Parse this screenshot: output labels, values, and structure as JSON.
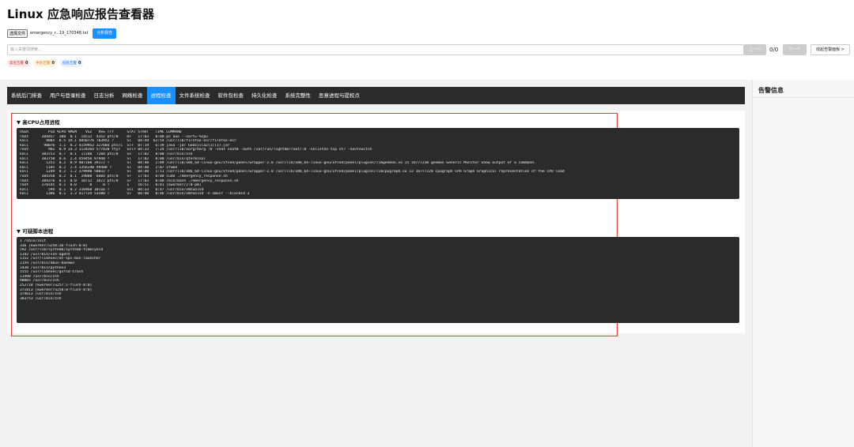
{
  "app": {
    "title": "Linux 应急响应报告查看器"
  },
  "file": {
    "choose_label": "选择文件",
    "file_name": "emergency_r...19_170348.txt",
    "analyze_label": "分析报告"
  },
  "search": {
    "placeholder": "输入关键词搜索...",
    "prev_label": "上一个",
    "match_count": "0/0",
    "next_label": "下一个",
    "toggle_label": "收起告警面板 >"
  },
  "badges": {
    "high": {
      "label": "高危告警",
      "count": "0"
    },
    "mid": {
      "label": "中危告警",
      "count": "0"
    },
    "low": {
      "label": "低危告警",
      "count": "0"
    }
  },
  "tabs": [
    {
      "label": "系统后门排查",
      "active": false
    },
    {
      "label": "用户与登录检查",
      "active": false
    },
    {
      "label": "日志分析",
      "active": false
    },
    {
      "label": "网络检查",
      "active": false
    },
    {
      "label": "进程检查",
      "active": true
    },
    {
      "label": "文件系统检查",
      "active": false
    },
    {
      "label": "软件包检查",
      "active": false
    },
    {
      "label": "持久化检查",
      "active": false
    },
    {
      "label": "系统完整性",
      "active": false
    },
    {
      "label": "恶意进程与提权点",
      "active": false
    }
  ],
  "sections": {
    "high_cpu": {
      "title": "▼ 高CPU占用进程",
      "lines": [
        "USER         PID %CPU %MEM    VSZ   RSS TTY      STAT START   TIME COMMAND",
        "root      384457  200  0.1  14512  4352 pts/0    R+   17:03   0:00 ps aux --sort=-%cpu",
        "kali        9085  8.5 19.1 4850776 763952 ?      Sl   04:49  62:54 /usr/lib/firefox-esr/firefox-esr",
        "kali       90076  1.1  8.2 4159952 327684 pts/1  Sl+  07:19   6:39 java -jar Godzilla2(1)(1).jar",
        "root         902  0.9 14.3 1134364 577420 tty7   Ssl+ 04:33   7:24 /usr/lib/xorg/Xorg :0 -seat seat0 -auth /var/run/lightdm/root/:0 -nolisten tcp vt7 -novtswitch",
        "kali      383753  0.7  0.1  17240  7260 pts/0    Ss   17:02   0:00 /usr/bin/zsh",
        "kali      383750  0.6  2.4 459456 97940 ?        Sl   17:02   0:00 /usr/bin/qterminal",
        "kali        1251  0.2  0.9 407160 39172 ?        Sl   04:40   2:09 /usr/lib/x86_64-linux-gnu/xfce4/panel/wrapper-2.0 /usr/lib/x86_64-linux-gnu/xfce4/panel/plugins/libgenmon.so 15 16777230 genmon Generic Monitor Show output of a command.",
        "kali        1185  0.2  2.4 1356240 99408 ?       Sl   04:40   2:07 xfwm4",
        "kali        1249  0.2  1.2 379948 50032 ?        Sl   04:40   1:51 /usr/lib/x86_64-linux-gnu/xfce4/panel/wrapper-2.0 /usr/lib/x86_64-linux-gnu/xfce4/panel/plugins/libcpugraph.so 13 16777228 cpugraph CPU Graph Graphical representation of the CPU load",
        "root      384350  0.2  0.1  19888  6604 pts/0    S+   17:03   0:00 sudo ./emergency_response.sh",
        "root      384376  0.1  0.0  10712  3672 pts/0    S+   17:03   0:00 /bin/bash ./emergency_response.sh",
        "root      378145  0.1  0.0      0     0 ?        I    16:51   0:01 [kworker/2:0-pm]",
        "kali         594  0.1  0.2 316468 10116 ?        Ssl  04:33   0:47 /usr/bin/vmtoolsd",
        "kali        1306  0.1  1.3 417724 53200 ?        Sl   04:40   0:46 /usr/bin/vmtoolsd -n vmusr --blockFd 3"
      ]
    },
    "suspicious": {
      "title": "▼ 可疑脚本进程",
      "lines": [
        "1 /sbin/init",
        "336 [kworker/u258:36-flush-8:0]",
        "592 /usr/lib/systemd/systemd-timesyncd",
        "1142 /usr/bin/ssh-agent",
        "1152 /usr/libexec/at-spi-bus-launcher",
        "1159 /usr/bin/dbus-daemon",
        "1430 /usr/bin/python3",
        "1555 /usr/libexec/gvfsd-trash",
        "11498 /usr/bin/zsh",
        "90065 /usr/bin/zsh",
        "252718 [kworker/u257:1-flush-8:0]",
        "371813 [kworker/u258:0-flush-8:0]",
        "374613 /usr/bin/zsh",
        "383753 /usr/bin/zsh"
      ]
    }
  },
  "right_panel": {
    "title": "告警信息"
  },
  "colors": {
    "accent": "#1890ff",
    "dark_bg": "#2b2b2b",
    "highlight_box": "#e53935"
  },
  "icons": {
    "collapse_section": "triangle-down-icon"
  }
}
